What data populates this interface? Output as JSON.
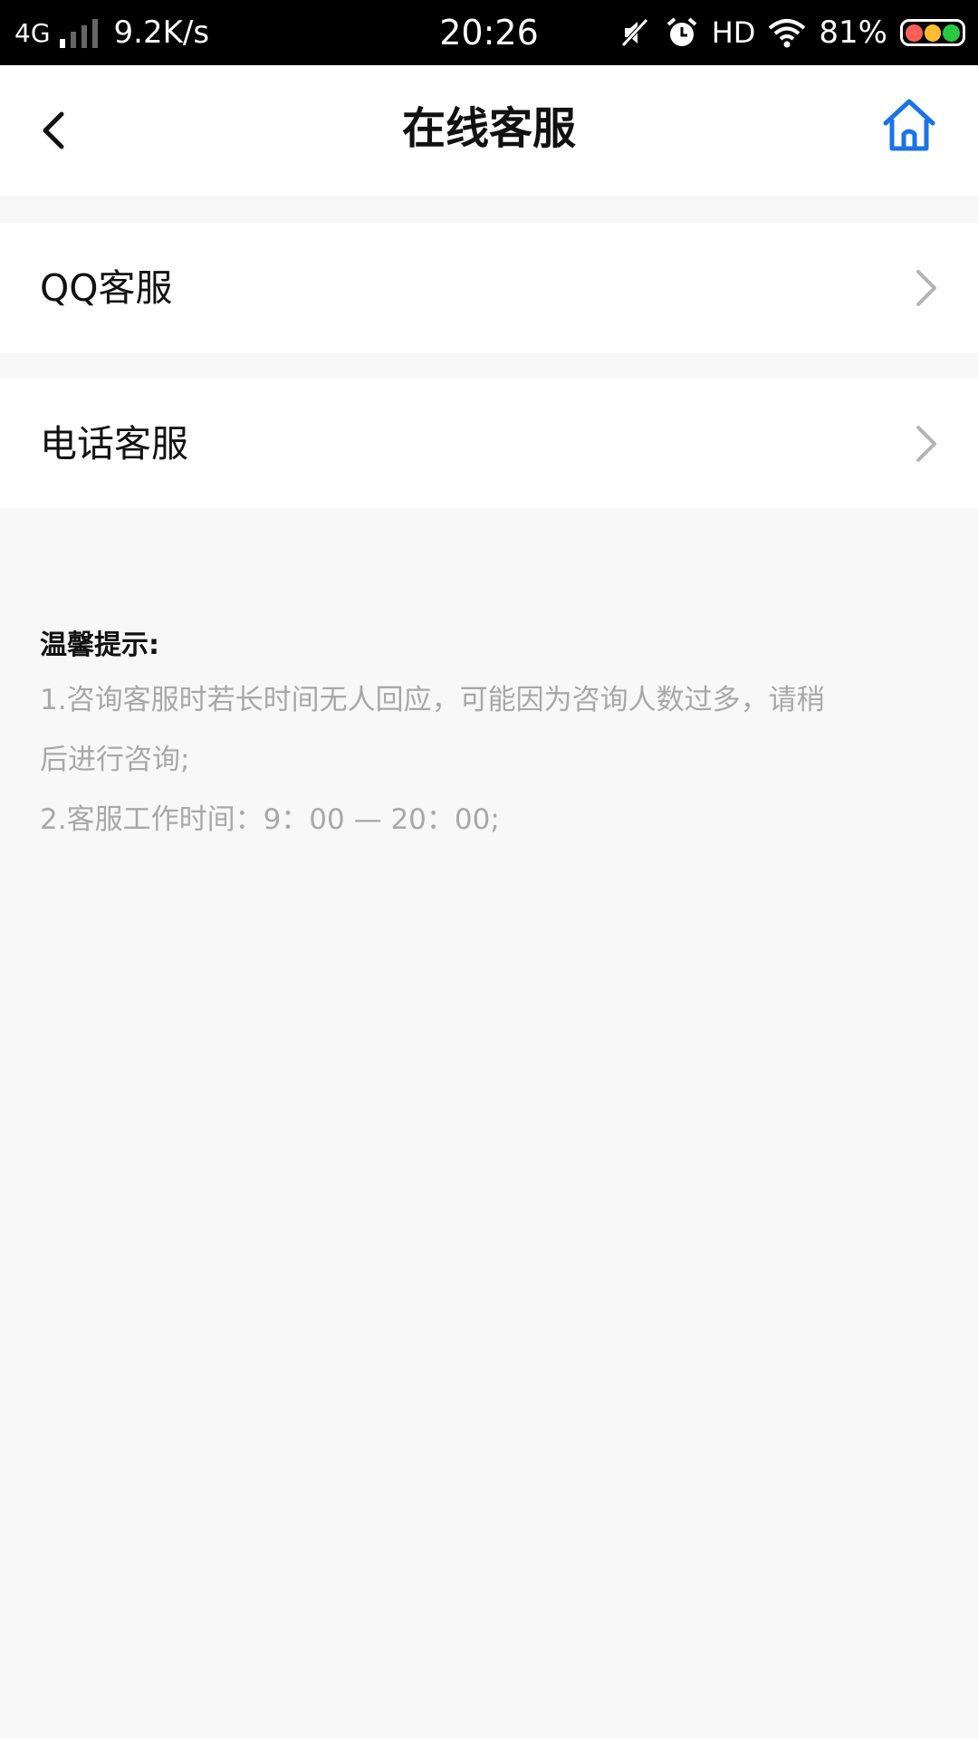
{
  "status_bar": {
    "network": "4G",
    "speed": "9.2K/s",
    "time": "20:26",
    "hd": "HD",
    "battery": "81%",
    "icons": [
      "mute-icon",
      "alarm-icon",
      "wifi-icon",
      "battery-icon"
    ]
  },
  "header": {
    "title": "在线客服",
    "back_icon": "chevron-left-icon",
    "home_icon": "home-icon",
    "home_color": "#1a73e8"
  },
  "menu": {
    "items": [
      {
        "label": "QQ客服",
        "icon": "chevron-right-icon"
      },
      {
        "label": "电话客服",
        "icon": "chevron-right-icon"
      }
    ]
  },
  "tips": {
    "title": "温馨提示:",
    "lines": [
      "1.咨询客服时若长时间无人回应，可能因为咨询人数过多，请稍",
      "后进行咨询;",
      "2.客服工作时间：9：00 — 20：00;"
    ]
  }
}
